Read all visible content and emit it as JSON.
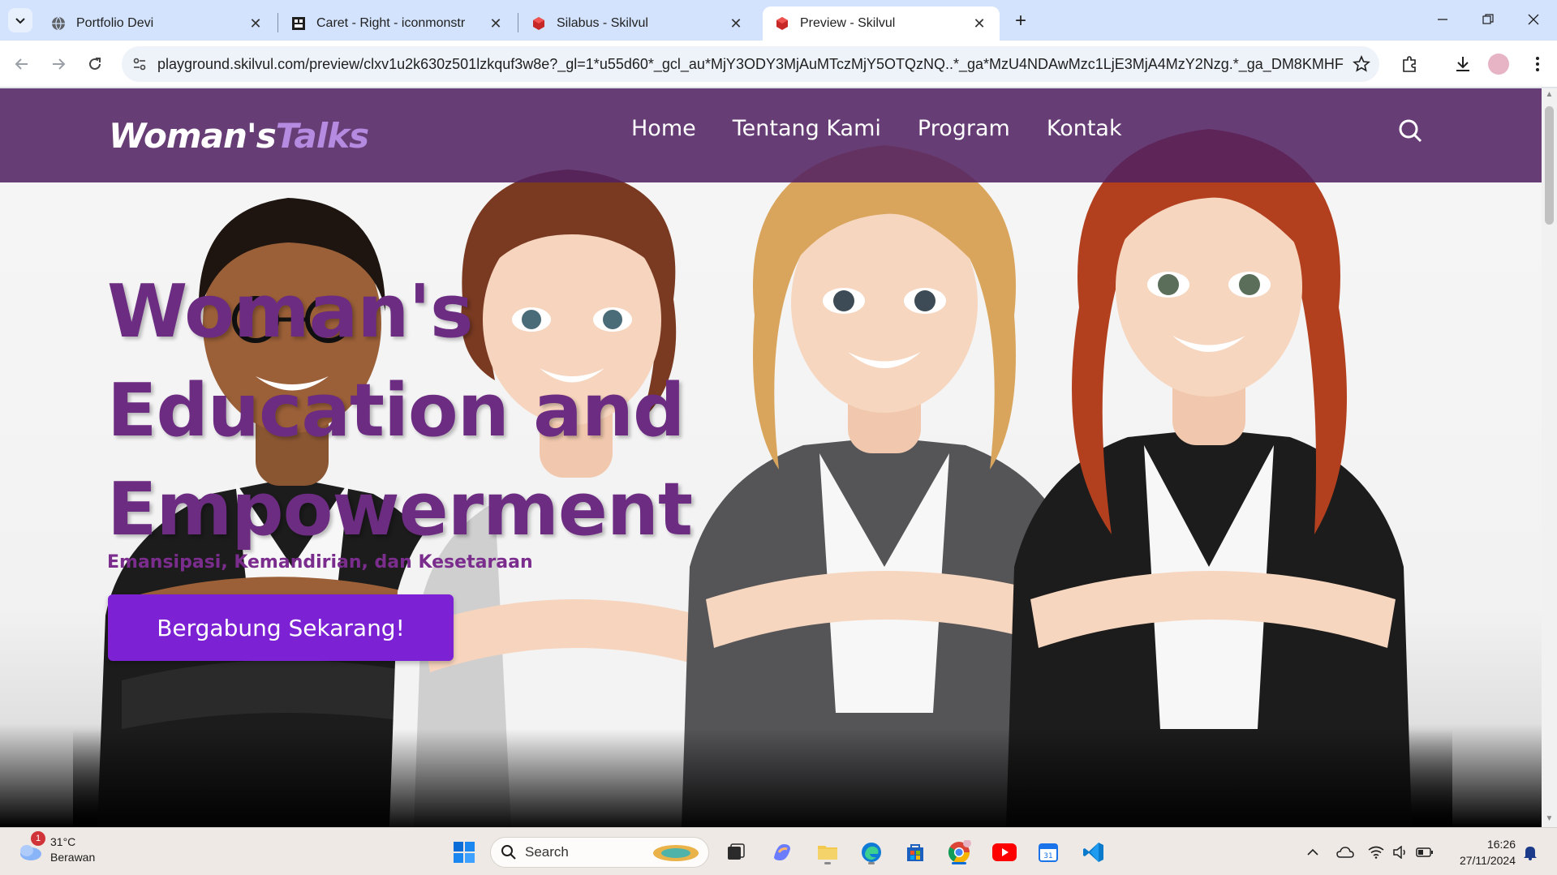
{
  "browser": {
    "tabs": [
      {
        "title": "Portfolio Devi",
        "favicon": "globe-icon",
        "active": false
      },
      {
        "title": "Caret - Right - iconmonstr",
        "favicon": "iconmonstr-icon",
        "active": false
      },
      {
        "title": "Silabus - Skilvul",
        "favicon": "skilvul-icon",
        "active": false
      },
      {
        "title": "Preview - Skilvul",
        "favicon": "skilvul-icon",
        "active": true
      }
    ],
    "new_tab": "+",
    "url": "playground.skilvul.com/preview/clxv1u2k630z501lzkquf3w8e?_gl=1*u55d60*_gcl_au*MjY3ODY3MjAuMTczMjY5OTQzNQ..*_ga*MzU4NDAwMzc1LjE3MjA4MzY2Nzg.*_ga_DM8KMHFGLC*..."
  },
  "site": {
    "logo_main": "Woman's",
    "logo_accent": "Talks",
    "nav": [
      "Home",
      "Tentang Kami",
      "Program",
      "Kontak"
    ],
    "hero": {
      "title_line1": "Woman's",
      "title_line2": "Education and",
      "title_line3": "Empowerment",
      "subtitle": "Emansipasi, Kemandirian, dan Kesetaraan",
      "cta": "Bergabung Sekarang!"
    },
    "colors": {
      "nav_bg": "#522162",
      "accent": "#b48be0",
      "hero_title": "#6b2c82",
      "cta_bg": "#7c21d4"
    }
  },
  "taskbar": {
    "weather": {
      "temp": "31°C",
      "condition": "Berawan",
      "badge": "1"
    },
    "search_label": "Search",
    "time": "16:26",
    "date": "27/11/2024"
  }
}
